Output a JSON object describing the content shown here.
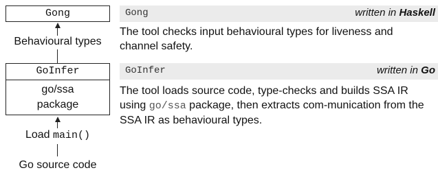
{
  "left_chain": {
    "gong_box": "Gong",
    "types_label": "Behavioural types",
    "goinfer_box": "GoInfer",
    "goinfer_sub_line1": "go/ssa",
    "goinfer_sub_line2": "package",
    "load_label_prefix": "Load",
    "load_label_code": "main()",
    "source_label": "Go source code"
  },
  "gong_panel": {
    "name": "Gong",
    "lang_prefix": "written in",
    "lang": "Haskell",
    "description": "The tool checks input behavioural types for liveness and channel safety."
  },
  "goinfer_panel": {
    "name": "GoInfer",
    "lang_prefix": "written in",
    "lang": "Go",
    "desc_part1": "The tool loads source code, type-checks and builds SSA IR using",
    "desc_code": "go/ssa",
    "desc_part2": "package, then extracts com-munication from the SSA IR as behavioural types."
  }
}
